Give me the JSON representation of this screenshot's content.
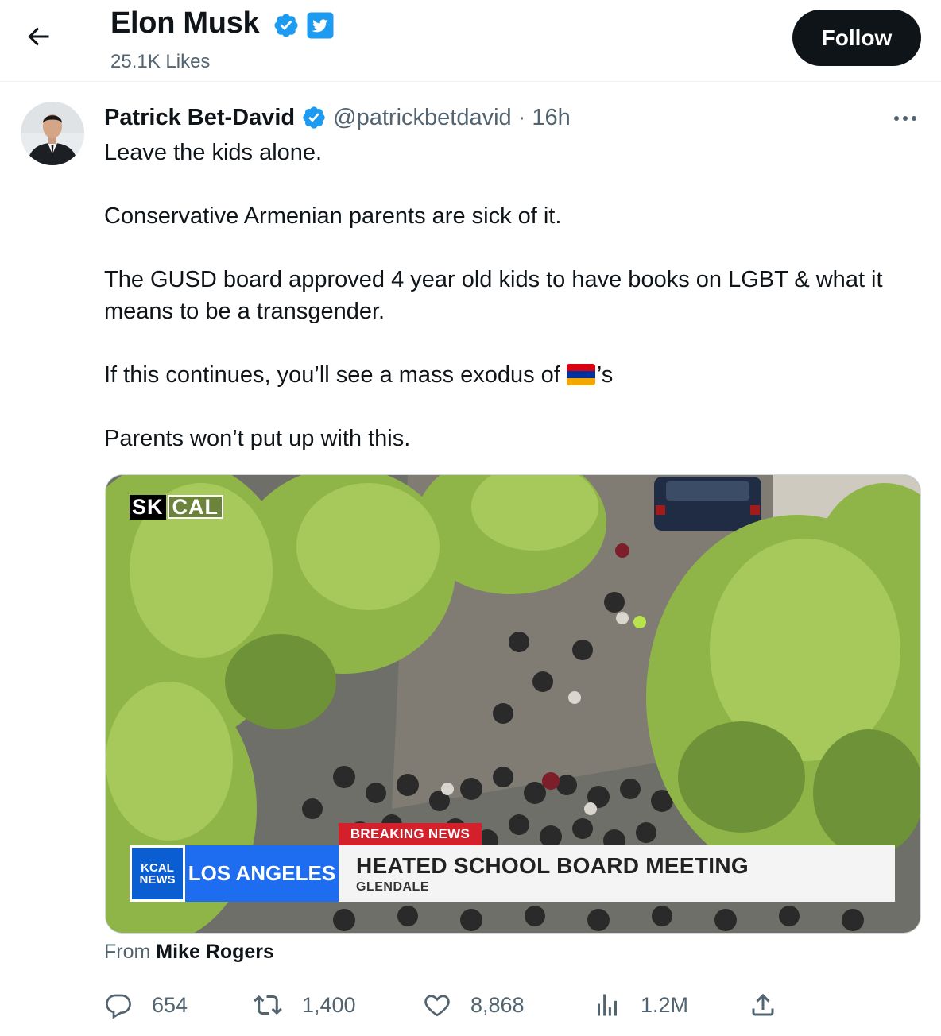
{
  "header": {
    "name": "Elon Musk",
    "likes": "25.1K Likes",
    "follow_label": "Follow",
    "icons": [
      "back-arrow-icon",
      "verified-badge-icon",
      "twitter-logo-badge-icon"
    ]
  },
  "tweet": {
    "author_name": "Patrick Bet-David",
    "handle": "@patrickbetdavid",
    "separator": "·",
    "time": "16h",
    "lines": [
      "Leave the kids alone.",
      "Conservative Armenian parents are sick of it.",
      "The GUSD board approved 4 year old kids to have books on LGBT & what it",
      "means to be a transgender.",
      "If this continues, you’ll see a mass exodus of",
      "’s",
      "Parents won’t put up with this."
    ],
    "flag_colors": [
      "#d90012",
      "#0033a0",
      "#f2a800"
    ]
  },
  "media": {
    "watermark_sk": "SK",
    "watermark_cal": "CAL",
    "logo_line1": "KCAL",
    "logo_line2": "NEWS",
    "city": "LOS ANGELES",
    "breaking": "BREAKING NEWS",
    "headline": "HEATED SCHOOL BOARD MEETING",
    "subheadline": "GLENDALE"
  },
  "attribution": {
    "prefix": "From",
    "name": "Mike Rogers"
  },
  "actions": {
    "replies": "654",
    "reposts": "1,400",
    "likes": "8,868",
    "views": "1.2M"
  },
  "colors": {
    "accent_blue": "#1d9bf0",
    "muted_text": "#536471",
    "breaking_red": "#d3202b",
    "kcal_blue": "#1e6df0"
  }
}
